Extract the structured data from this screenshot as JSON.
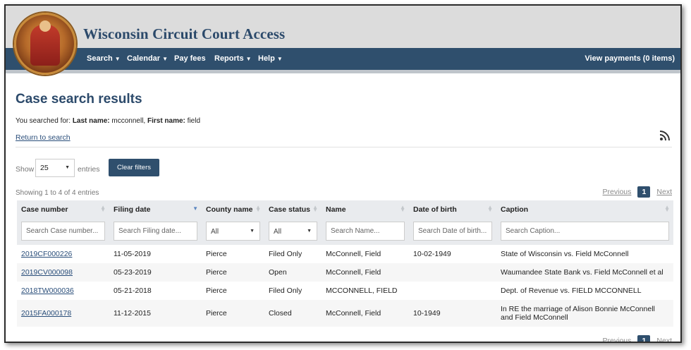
{
  "site": {
    "title": "Wisconsin Circuit Court Access"
  },
  "nav": {
    "items": [
      {
        "label": "Search",
        "has_caret": true
      },
      {
        "label": "Calendar",
        "has_caret": true
      },
      {
        "label": "Pay fees",
        "has_caret": false
      },
      {
        "label": "Reports",
        "has_caret": true
      },
      {
        "label": "Help",
        "has_caret": true
      }
    ],
    "right": "View payments (0 items)"
  },
  "page": {
    "title": "Case search results",
    "searched_prefix": "You searched for:",
    "last_name_label": "Last name:",
    "last_name_value": "mcconnell,",
    "first_name_label": "First name:",
    "first_name_value": "field",
    "return_link": "Return to search"
  },
  "controls": {
    "show_label": "Show",
    "entries_value": "25",
    "entries_label": "entries",
    "clear_filters": "Clear filters",
    "showing_text": "Showing 1 to 4 of 4 entries"
  },
  "pagination": {
    "previous": "Previous",
    "current": "1",
    "next": "Next"
  },
  "table": {
    "columns": [
      "Case number",
      "Filing date",
      "County name",
      "Case status",
      "Name",
      "Date of birth",
      "Caption"
    ],
    "filters": {
      "case_number": "Search Case number...",
      "filing_date": "Search Filing date...",
      "county": "All",
      "status": "All",
      "name": "Search Name...",
      "dob": "Search Date of birth...",
      "caption": "Search Caption..."
    },
    "rows": [
      {
        "case": "2019CF000226",
        "filed": "11-05-2019",
        "county": "Pierce",
        "status": "Filed Only",
        "name": "McConnell, Field",
        "dob": "10-02-1949",
        "caption": "State of Wisconsin vs. Field McConnell"
      },
      {
        "case": "2019CV000098",
        "filed": "05-23-2019",
        "county": "Pierce",
        "status": "Open",
        "name": "McConnell, Field",
        "dob": "",
        "caption": "Waumandee State Bank vs. Field McConnell et al"
      },
      {
        "case": "2018TW000036",
        "filed": "05-21-2018",
        "county": "Pierce",
        "status": "Filed Only",
        "name": "MCCONNELL, FIELD",
        "dob": "",
        "caption": "Dept. of Revenue vs. FIELD MCCONNELL"
      },
      {
        "case": "2015FA000178",
        "filed": "11-12-2015",
        "county": "Pierce",
        "status": "Closed",
        "name": "McConnell, Field",
        "dob": "10-1949",
        "caption": "In RE the marriage of Alison Bonnie McConnell and Field McConnell"
      }
    ]
  },
  "colors": {
    "navy": "#2f4f6d",
    "title": "#2c4a6b",
    "link": "#2a4e7a",
    "rss": "#e07a1c"
  }
}
